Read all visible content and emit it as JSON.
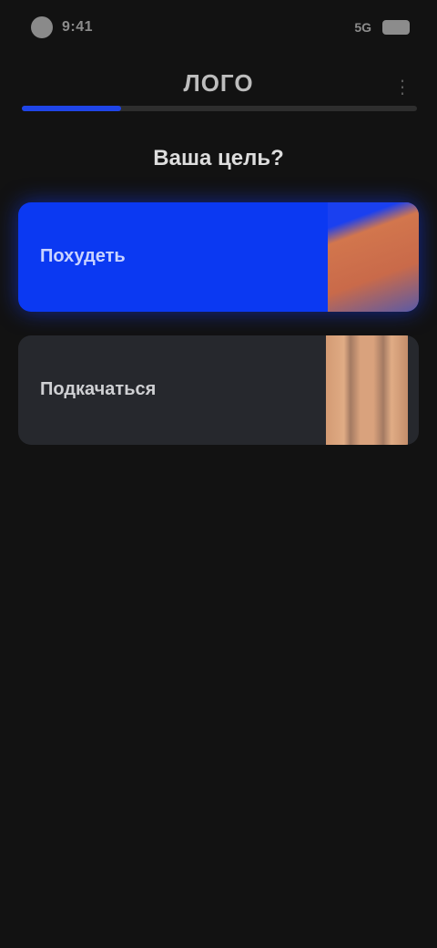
{
  "status_bar": {
    "time": "9:41",
    "icons": "5G"
  },
  "header": {
    "title": "ЛОГО",
    "menu_icon": "more-icon",
    "progress": 0.25
  },
  "question": "Ваша цель?",
  "options": [
    {
      "label": "Похудеть",
      "image": "body-shape-image",
      "selected": true
    },
    {
      "label": "Подкачаться",
      "image": "body-legs-image",
      "selected": false
    }
  ],
  "colors": {
    "background": "#121212",
    "accent": "#0b39f2",
    "card": "#26282d"
  }
}
